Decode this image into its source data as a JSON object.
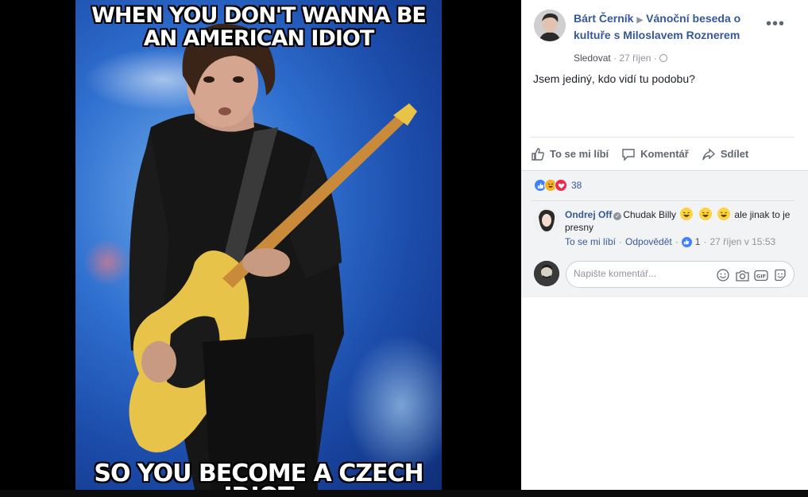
{
  "meme": {
    "top_line1": "WHEN YOU DON'T WANNA BE",
    "top_line2": "AN AMERICAN IDIOT",
    "bottom_line": "SO YOU BECOME A CZECH IDIOT"
  },
  "post": {
    "author": "Bárt Černík",
    "group": "Vánoční beseda o kultuře s Miloslavem Roznerem",
    "follow_label": "Sledovat",
    "date": "27 říjen",
    "text": "Jsem jediný, kdo vidí tu podobu?"
  },
  "actions": {
    "like": "To se mi líbí",
    "comment": "Komentář",
    "share": "Sdílet"
  },
  "reactions": {
    "count": "38",
    "types": [
      "like-icon",
      "haha-icon",
      "love-icon"
    ]
  },
  "comment": {
    "author": "Ondrej Off",
    "text_before": "Chudak Billy",
    "text_after": "ale jinak to je presny",
    "like_label": "To se mi líbí",
    "reply_label": "Odpovědět",
    "like_count": "1",
    "time": "27 říjen v 15:53"
  },
  "composer": {
    "placeholder": "Napište komentář..."
  },
  "colors": {
    "link": "#365899",
    "muted": "#90949c",
    "like_blue": "#4080ff"
  }
}
